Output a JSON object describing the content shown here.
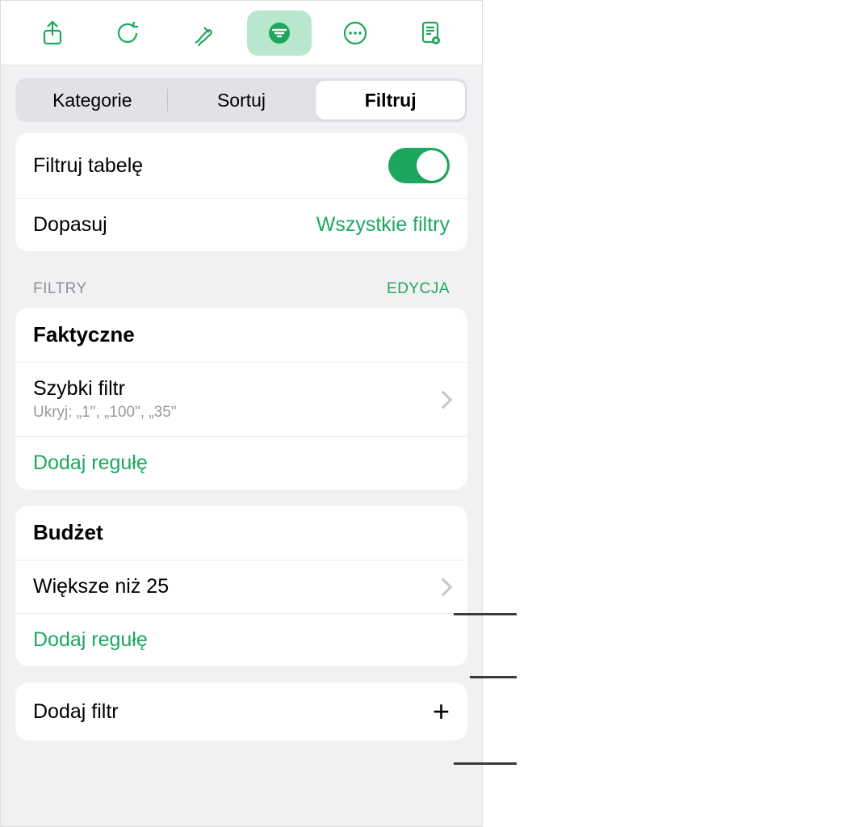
{
  "toolbar_icons": [
    "share",
    "undo",
    "format",
    "filter",
    "more",
    "document"
  ],
  "segments": {
    "categories": "Kategorie",
    "sort": "Sortuj",
    "filter": "Filtruj"
  },
  "options": {
    "filter_table": "Filtruj tabelę",
    "match_label": "Dopasuj",
    "match_value": "Wszystkie filtry"
  },
  "section": {
    "title": "FILTRY",
    "edit": "EDYCJA"
  },
  "groups": [
    {
      "heading": "Faktyczne",
      "rules": [
        {
          "title": "Szybki filtr",
          "subtitle": "Ukryj: „1\", „100\", „35\""
        }
      ],
      "add_rule": "Dodaj regułę"
    },
    {
      "heading": "Budżet",
      "rules": [
        {
          "title": "Większe niż 25",
          "subtitle": ""
        }
      ],
      "add_rule": "Dodaj regułę"
    }
  ],
  "add_filter": "Dodaj filtr"
}
